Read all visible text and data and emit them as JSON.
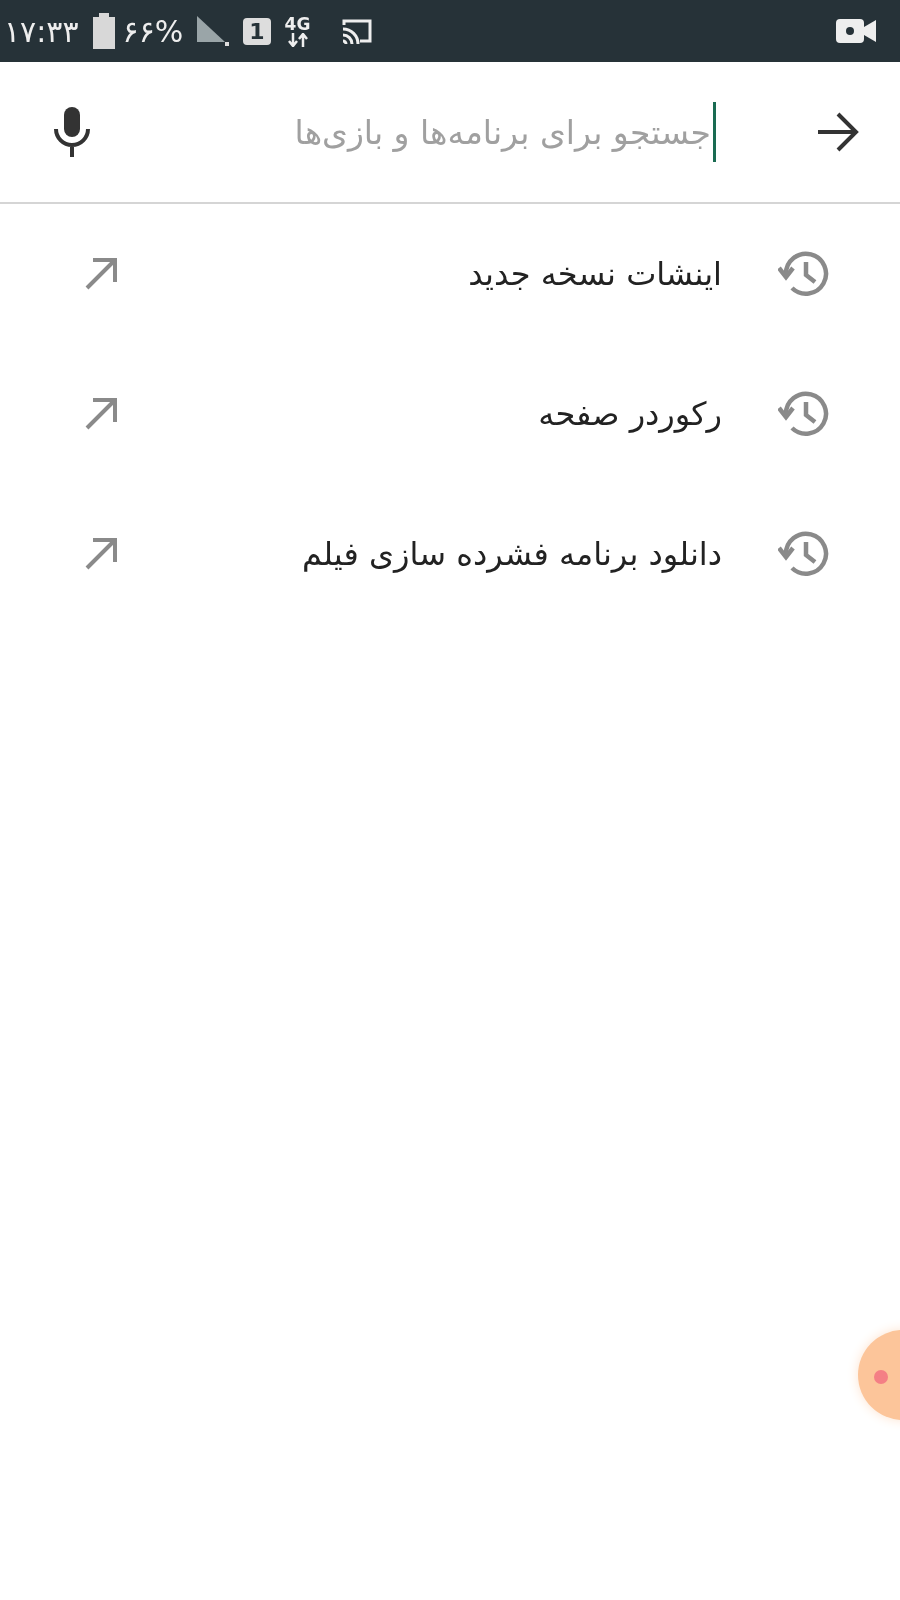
{
  "status_bar": {
    "time": "۱۷:۳۳",
    "battery": "۶۶%",
    "sim": "1",
    "network": "4G"
  },
  "search": {
    "placeholder": "جستجو برای برنامه‌ها و بازی‌ها"
  },
  "suggestions": [
    {
      "label": "اینشات نسخه جدید"
    },
    {
      "label": "رکوردر صفحه"
    },
    {
      "label": "دانلود برنامه فشرده سازی فیلم"
    }
  ]
}
